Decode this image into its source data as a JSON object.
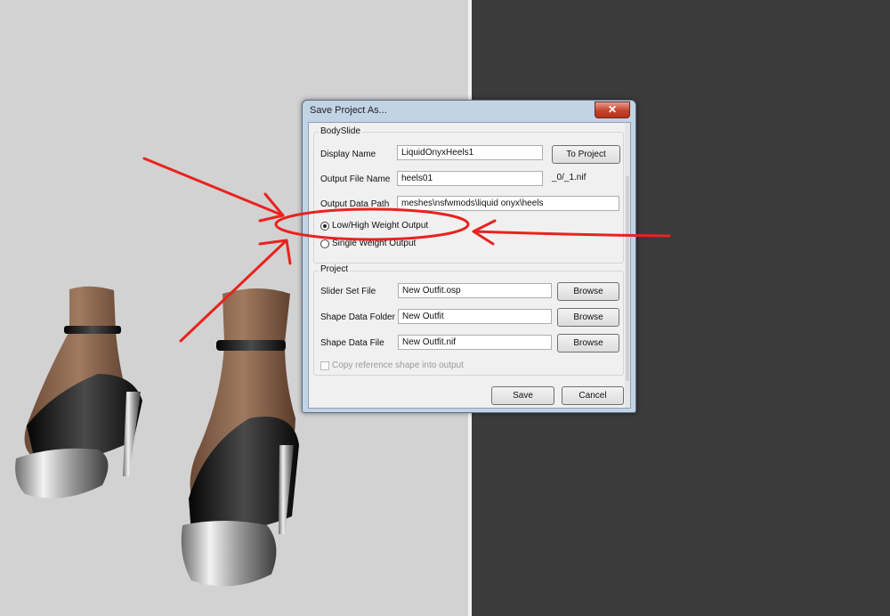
{
  "dialog": {
    "title": "Save Project As...",
    "close_glyph": "✕"
  },
  "bodyslide": {
    "group_title": "BodySlide",
    "display_name_label": "Display Name",
    "display_name_value": "LiquidOnyxHeels1",
    "to_project_label": "To Project",
    "output_file_label": "Output File Name",
    "output_file_value": "heels01",
    "output_suffix": "_0/_1.nif",
    "output_path_label": "Output Data Path",
    "output_path_value": "meshes\\nsfwmods\\liquid onyx\\heels",
    "radio_low_high": "Low/High Weight Output",
    "radio_single": "Single Weight Output",
    "selected_radio": "low_high"
  },
  "project": {
    "group_title": "Project",
    "slider_set_label": "Slider Set File",
    "slider_set_value": "New Outfit.osp",
    "shape_folder_label": "Shape Data Folder",
    "shape_folder_value": "New Outfit",
    "shape_file_label": "Shape Data File",
    "shape_file_value": "New Outfit.nif",
    "browse_label": "Browse",
    "copy_ref_label": "Copy reference shape into output"
  },
  "footer": {
    "save_label": "Save",
    "cancel_label": "Cancel"
  },
  "colors": {
    "annotation": "#e8231f",
    "viewport_left": "#d2d2d2",
    "viewport_right": "#3b3b3b"
  }
}
